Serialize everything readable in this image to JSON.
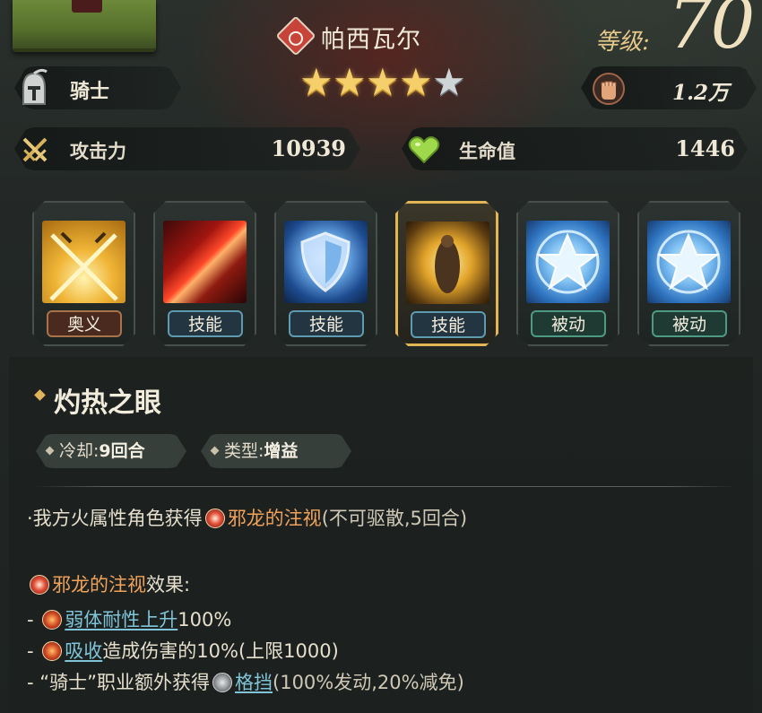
{
  "character": {
    "name": "帕西瓦尔",
    "class": "骑士",
    "stars_total": 5,
    "stars_filled": 4,
    "level_label": "等级:",
    "level": "70",
    "power": "1.2万"
  },
  "stats": {
    "attack": {
      "label": "攻击力",
      "value": "10939"
    },
    "hp": {
      "label": "生命值",
      "value": "1446"
    }
  },
  "skills": [
    {
      "tag": "奥义",
      "kind": "ultimate",
      "selected": false
    },
    {
      "tag": "技能",
      "kind": "active",
      "selected": false
    },
    {
      "tag": "技能",
      "kind": "active",
      "selected": false
    },
    {
      "tag": "技能",
      "kind": "active",
      "selected": true
    },
    {
      "tag": "被动",
      "kind": "passive",
      "selected": false
    },
    {
      "tag": "被动",
      "kind": "passive",
      "selected": false
    }
  ],
  "detail": {
    "title": "灼热之眼",
    "cooldown_label": "冷却:",
    "cooldown_value": "9回合",
    "type_label": "类型:",
    "type_value": "增益",
    "line1_prefix": "·我方火属性角色获得",
    "line1_buff": "邪龙的注视",
    "line1_suffix": "(不可驱散,5回合)",
    "effect_buff": "邪龙的注视",
    "effect_suffix": "效果:",
    "effects": [
      {
        "prefix": "- ",
        "link": "弱体耐性上升",
        "text": "100%"
      },
      {
        "prefix": "- ",
        "link": "吸收",
        "text": "造成伤害的10%(上限1000)"
      },
      {
        "prefix": "- “骑士”职业额外获得",
        "link": "格挡",
        "text": "(100%发动,20%减免)"
      }
    ]
  },
  "colors": {
    "accent_gold": "#e2b654",
    "buff_orange": "#f0a25a",
    "link_cyan": "#7fc4d8"
  },
  "icons": {
    "class": "knight-helmet-icon",
    "element": "fire-element-icon",
    "power": "fist-power-icon",
    "attack": "crossed-swords-icon",
    "hp": "heart-icon"
  }
}
